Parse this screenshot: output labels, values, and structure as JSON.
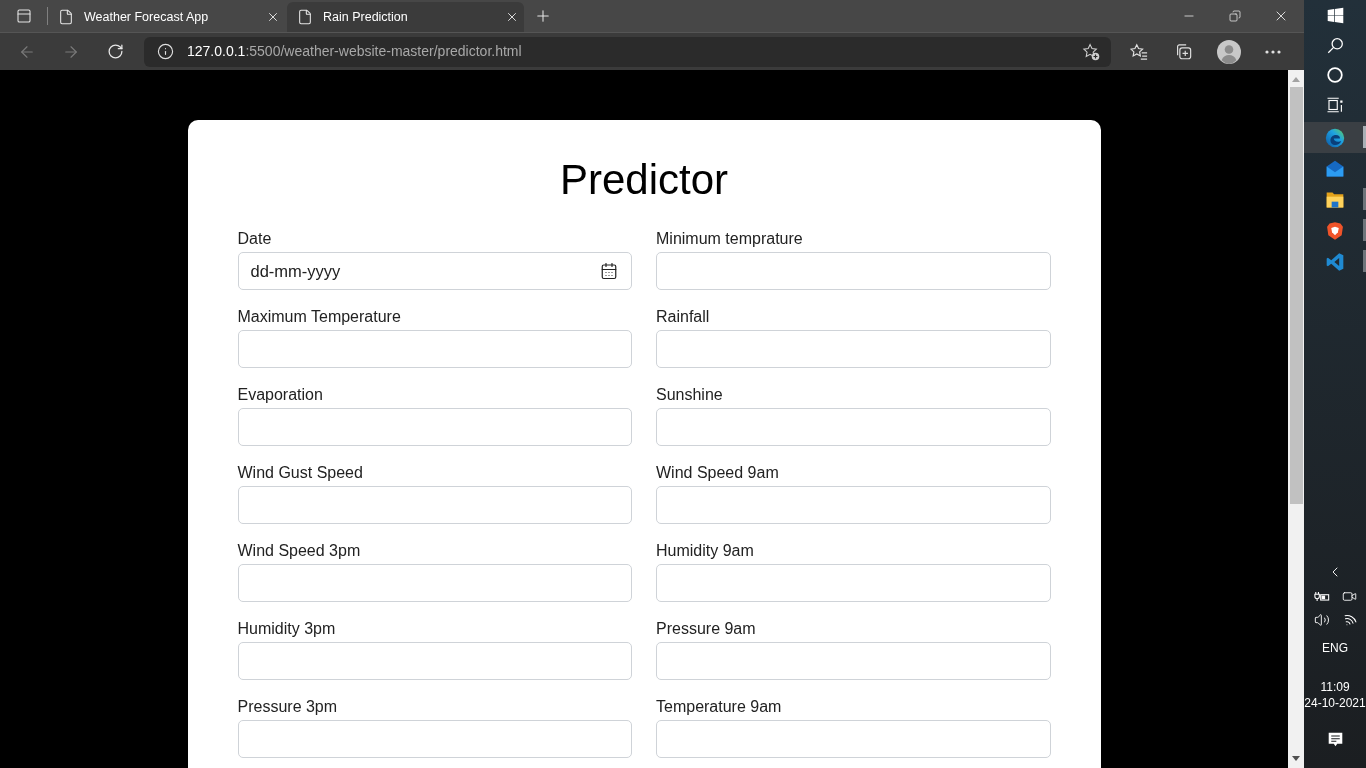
{
  "browser": {
    "tabs": [
      {
        "title": "Weather Forecast App",
        "selected": false
      },
      {
        "title": "Rain Prediction",
        "selected": true
      }
    ],
    "navigation": [
      {
        "kind": "back",
        "disabled": true
      },
      {
        "kind": "forward",
        "disabled": true
      },
      {
        "kind": "reload",
        "disabled": false
      }
    ],
    "address": {
      "host": "127.0.0.1",
      "path": ":5500/weather-website-master/predictor.html"
    }
  },
  "form": {
    "title": "Predictor",
    "fields": [
      {
        "label": "Date",
        "kind": "date",
        "placeholder": "dd-mm-yyyy"
      },
      {
        "label": "Minimum temprature",
        "kind": "number"
      },
      {
        "label": "Maximum Temperature",
        "kind": "number"
      },
      {
        "label": "Rainfall",
        "kind": "number"
      },
      {
        "label": "Evaporation",
        "kind": "number"
      },
      {
        "label": "Sunshine",
        "kind": "number"
      },
      {
        "label": "Wind Gust Speed",
        "kind": "number"
      },
      {
        "label": "Wind Speed 9am",
        "kind": "number"
      },
      {
        "label": "Wind Speed 3pm",
        "kind": "number"
      },
      {
        "label": "Humidity 9am",
        "kind": "number"
      },
      {
        "label": "Humidity 3pm",
        "kind": "number"
      },
      {
        "label": "Pressure 9am",
        "kind": "number"
      },
      {
        "label": "Pressure 3pm",
        "kind": "number"
      },
      {
        "label": "Temperature 9am",
        "kind": "number"
      }
    ]
  },
  "taskbar": {
    "apps": [
      {
        "kind": "browser",
        "running": true,
        "selected": true
      },
      {
        "kind": "mail",
        "running": false,
        "selected": false
      },
      {
        "kind": "folder",
        "running": true,
        "selected": false
      },
      {
        "kind": "shield",
        "running": true,
        "selected": false
      },
      {
        "kind": "editor",
        "running": true,
        "selected": false
      }
    ],
    "language": "ENG",
    "time": "11:09",
    "date": "24-10-2021"
  }
}
